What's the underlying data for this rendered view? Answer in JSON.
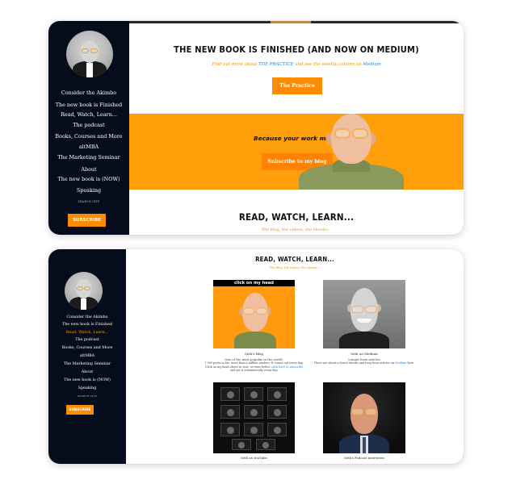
{
  "site": {
    "nav": [
      "Consider the Akimbo",
      "The new book is Finished",
      "Read, Watch, Learn...",
      "The podcast",
      "Books, Courses and More",
      "altMBA",
      "The Marketing Seminar",
      "About",
      "The new book is (NOW)",
      "Speaking"
    ],
    "nav_small": "SEARCH SITE",
    "subscribe_label": "SUBSCRIBE"
  },
  "screen1": {
    "heading": "THE NEW BOOK IS FINISHED (AND NOW ON MEDIUM)",
    "sub_pre": "Find out more about ",
    "sub_link1": "THE PRACTICE",
    "sub_mid": " and see the weekly column on ",
    "sub_link2": "Medium",
    "button": "The Practice",
    "banner_tagline": "Because your work matters.",
    "banner_button": "Subscribe to my blog",
    "section_heading": "READ, WATCH, LEARN...",
    "section_sub": "The blog, the videos, the ebooks..."
  },
  "screen2": {
    "active_nav_index": 2,
    "heading": "READ, WATCH, LEARN...",
    "sub": "The blog, the videos, the ebooks...",
    "tiles": [
      {
        "banner": "click on my head",
        "caption": "Seth's Blog",
        "line1": "One of the most popular in the world.",
        "line2": "7,000 posts so far, more than a million readers. It comes out every day. Click on my head above to visit, or even better,",
        "link": "click here to subscribe",
        "line3": "and get it automatically every day."
      },
      {
        "caption": "Seth on Medium",
        "line1": "Longer form articles",
        "line2": "There are about a dozen ebooks and long form articles on",
        "link": "Medium",
        "line3": "here."
      },
      {
        "caption": "Seth on YouTube"
      },
      {
        "caption": "Seth's Podcast Interviews"
      }
    ]
  },
  "colors": {
    "sidebar": "#050c1c",
    "accent": "#ff9900",
    "banner": "#ff9f0a",
    "link": "#1e88e5"
  }
}
